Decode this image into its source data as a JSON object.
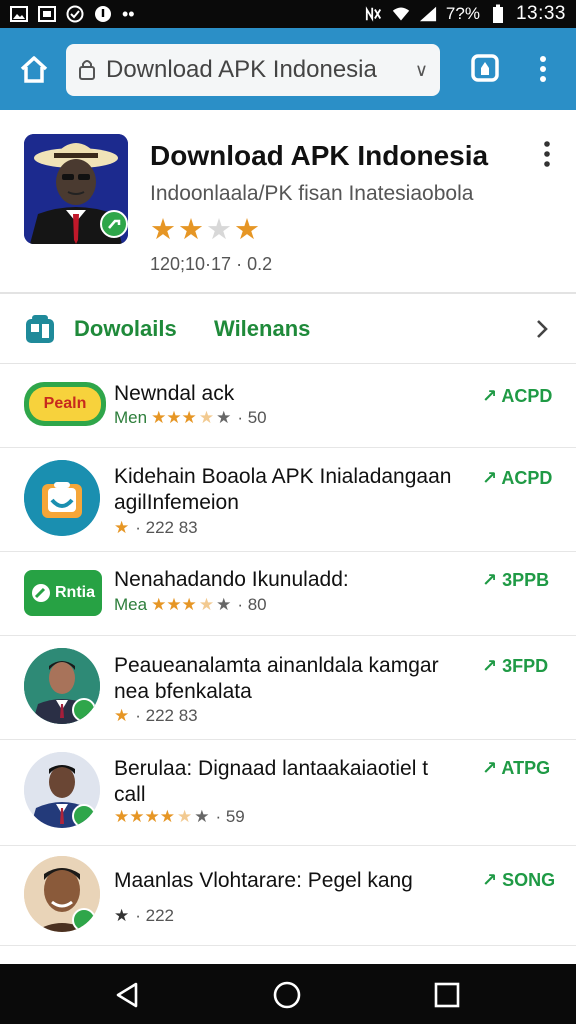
{
  "status_bar": {
    "battery_text": "7?%",
    "time": "13:33"
  },
  "browser": {
    "url_text": "Download APK Indonesia"
  },
  "app": {
    "title": "Download APK Indonesia",
    "subtitle": "Indoonlaala/PK fisan Inatesiaobola",
    "rating_stars": 3,
    "meta": "120;10·17 · 0.2"
  },
  "tabs": [
    {
      "label": "Dowolails"
    },
    {
      "label": "Wilenans"
    }
  ],
  "list": [
    {
      "title": "Newndal ack",
      "rating_prefix": "Men",
      "rating_stars": 3.5,
      "rating_suffix": "· 50",
      "price": "↗ ACPD",
      "icon_label": "Pealn",
      "icon": "yellow-pill-icon"
    },
    {
      "title": "Kidehain Boaola APK Inialadangaan agilInfemeion",
      "rating_prefix": "",
      "rating_stars": 1,
      "rating_suffix": "· 222 83",
      "price": "↗ ACPD",
      "icon": "shopping-bag-icon"
    },
    {
      "title": "Nenahadando Ikunuladd:",
      "rating_prefix": "Mea",
      "rating_stars": 3.5,
      "rating_suffix": "· 80",
      "price": "↗ 3PPB",
      "icon_label": "Rntia",
      "icon": "green-rect-icon"
    },
    {
      "title": "Peaueanalamta ainanldala kamgar nea bfenkalata",
      "rating_prefix": "",
      "rating_stars": 1,
      "rating_suffix": "· 222 83",
      "price": "↗ 3FPD",
      "icon": "man-avatar-icon"
    },
    {
      "title": "Berulaa: Dignaad lantaakaiaotiel t call",
      "rating_prefix": "",
      "rating_stars": 4.5,
      "rating_suffix": "· 59",
      "price": "↗ ATPG",
      "icon": "man-suit-avatar-icon"
    },
    {
      "title": "Maanlas Vlohtarare: Pegel kang",
      "rating_prefix": "",
      "rating_stars": 1,
      "rating_suffix": "· 222",
      "price": "↗ SONG",
      "icon": "man-casual-avatar-icon"
    }
  ],
  "colors": {
    "toolbar": "#2b8fc7",
    "accent_green": "#1f8a3a",
    "star": "#e69625"
  }
}
